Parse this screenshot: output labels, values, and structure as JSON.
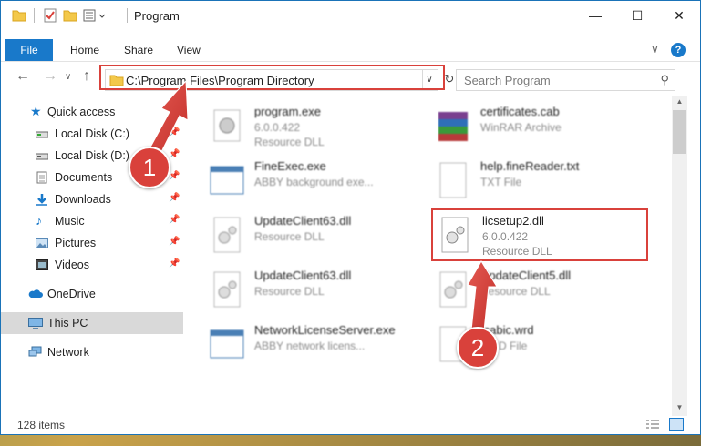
{
  "window": {
    "title": "Program"
  },
  "ribbon": {
    "file_label": "File",
    "tabs": [
      "Home",
      "Share",
      "View"
    ],
    "help": "?"
  },
  "nav": {
    "address": "C:\\Program Files\\Program Directory",
    "search_placeholder": "Search Program",
    "back_icon": "back-arrow-icon",
    "forward_icon": "forward-arrow-icon",
    "up_icon": "up-arrow-icon"
  },
  "sidebar": {
    "items": [
      {
        "label": "Quick access",
        "icon": "star-icon",
        "pinned": false
      },
      {
        "label": "Local Disk (C:)",
        "icon": "drive-icon",
        "pinned": true
      },
      {
        "label": "Local Disk (D:)",
        "icon": "drive-icon",
        "pinned": true
      },
      {
        "label": "Documents",
        "icon": "documents-icon",
        "pinned": true
      },
      {
        "label": "Downloads",
        "icon": "download-icon",
        "pinned": true
      },
      {
        "label": "Music",
        "icon": "music-icon",
        "pinned": true
      },
      {
        "label": "Pictures",
        "icon": "pictures-icon",
        "pinned": true
      },
      {
        "label": "Videos",
        "icon": "videos-icon",
        "pinned": true
      },
      {
        "label": "OneDrive",
        "icon": "cloud-icon",
        "pinned": false
      },
      {
        "label": "This PC",
        "icon": "pc-icon",
        "pinned": false,
        "selected": true
      },
      {
        "label": "Network",
        "icon": "network-icon",
        "pinned": false
      }
    ]
  },
  "files": [
    {
      "name": "program.exe",
      "line2": "6.0.0.422",
      "line3": "Resource DLL",
      "icon": "exe-icon"
    },
    {
      "name": "certificates.cab",
      "line2": "WinRAR Archive",
      "line3": "",
      "icon": "winrar-icon"
    },
    {
      "name": "FineExec.exe",
      "line2": "ABBY background exe...",
      "line3": "",
      "icon": "window-icon"
    },
    {
      "name": "help.fineReader.txt",
      "line2": "TXT File",
      "line3": "",
      "icon": "text-file-icon"
    },
    {
      "name": "UpdateClient63.dll",
      "line2": "Resource DLL",
      "line3": "",
      "icon": "dll-icon"
    },
    {
      "name": "licsetup2.dll",
      "line2": "6.0.0.422",
      "line3": "Resource DLL",
      "icon": "dll-icon"
    },
    {
      "name": "UpdateClient63.dll",
      "line2": "Resource DLL",
      "line3": "",
      "icon": "dll-icon"
    },
    {
      "name": "UpdateClient5.dll",
      "line2": "Resource DLL",
      "line3": "",
      "icon": "dll-icon"
    },
    {
      "name": "NetworkLicenseServer.exe",
      "line2": "ABBY network licens...",
      "line3": "",
      "icon": "window-icon"
    },
    {
      "name": "fcabic.wrd",
      "line2": "WRD File",
      "line3": "",
      "icon": "dll-icon"
    }
  ],
  "status": {
    "item_count": "128 items"
  },
  "annotations": {
    "badge1": "1",
    "badge2": "2",
    "color": "#d9413b"
  }
}
